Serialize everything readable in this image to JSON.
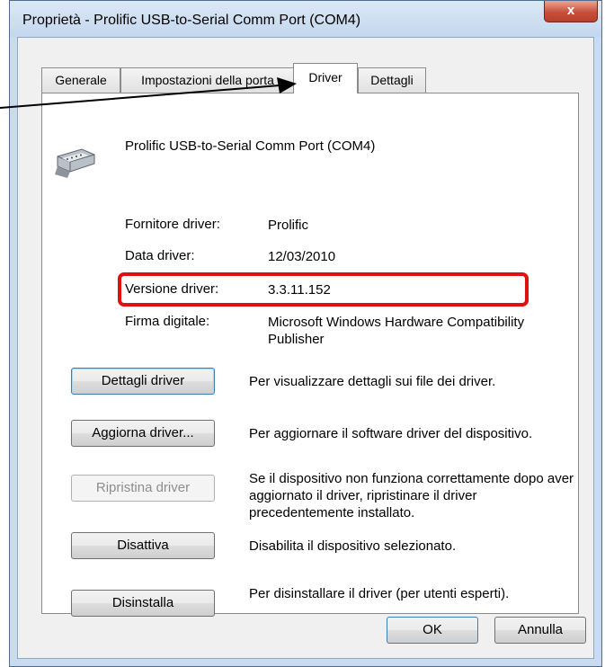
{
  "window": {
    "title": "Proprietà - Prolific USB-to-Serial Comm Port (COM4)",
    "close_label": "x"
  },
  "tabs": [
    {
      "label": "Generale",
      "active": false
    },
    {
      "label": "Impostazioni della porta",
      "active": false
    },
    {
      "label": "Driver",
      "active": true
    },
    {
      "label": "Dettagli",
      "active": false
    }
  ],
  "device": {
    "icon": "serial-port-icon",
    "name": "Prolific USB-to-Serial Comm Port (COM4)"
  },
  "properties": [
    {
      "label": "Fornitore driver:",
      "value": "Prolific"
    },
    {
      "label": "Data driver:",
      "value": "12/03/2010"
    },
    {
      "label": "Versione driver:",
      "value": "3.3.11.152"
    },
    {
      "label": "Firma digitale:",
      "value": "Microsoft Windows Hardware Compatibility Publisher"
    }
  ],
  "actions": [
    {
      "label": "Dettagli driver",
      "description": "Per visualizzare dettagli sui file dei driver.",
      "enabled": true
    },
    {
      "label": "Aggiorna driver...",
      "description": "Per aggiornare il software driver del dispositivo.",
      "enabled": true
    },
    {
      "label": "Ripristina driver",
      "description": "Se il dispositivo non funziona correttamente dopo aver aggiornato il driver, ripristinare il driver precedentemente installato.",
      "enabled": false
    },
    {
      "label": "Disattiva",
      "description": "Disabilita il dispositivo selezionato.",
      "enabled": true
    },
    {
      "label": "Disinstalla",
      "description": "Per disinstallare il driver (per utenti esperti).",
      "enabled": true
    }
  ],
  "footer": {
    "ok_label": "OK",
    "cancel_label": "Annulla"
  },
  "colors": {
    "highlight": "#e01010",
    "title_bar": "#c9dbef",
    "close_button": "#c8503b"
  }
}
